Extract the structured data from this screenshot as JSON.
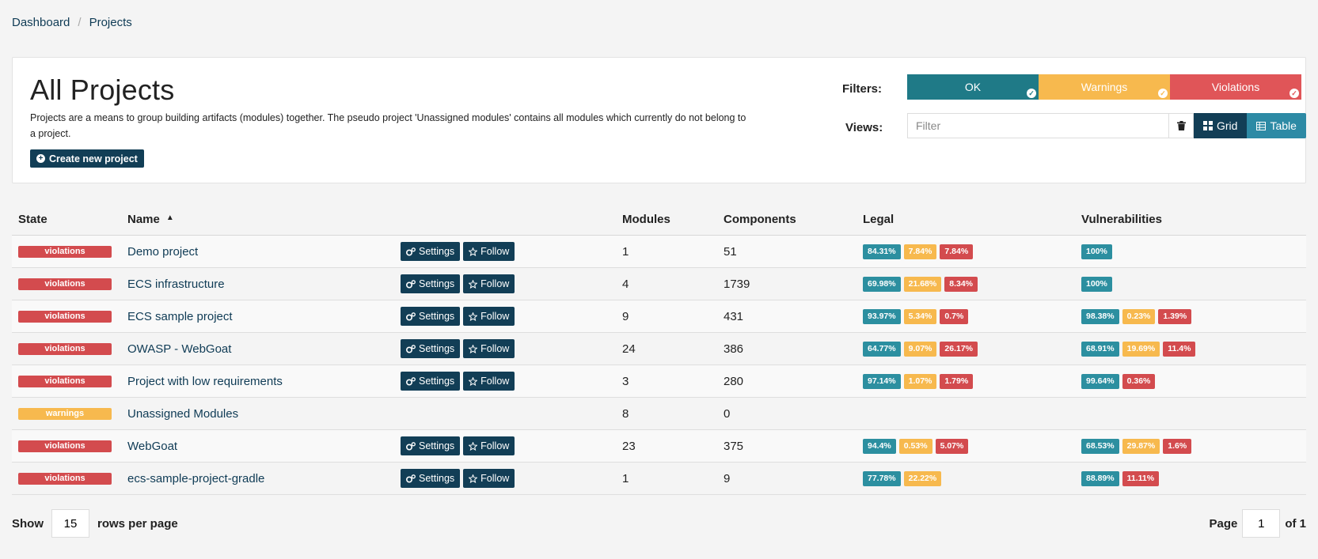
{
  "breadcrumb": {
    "items": [
      "Dashboard",
      "Projects"
    ],
    "separator": "/"
  },
  "header": {
    "title": "All Projects",
    "description": "Projects are a means to group building artifacts (modules) together. The pseudo project 'Unassigned modules' contains all modules which currently do not belong to a project.",
    "create_button": "Create new project"
  },
  "filters": {
    "label": "Filters:",
    "ok": "OK",
    "warnings": "Warnings",
    "violations": "Violations"
  },
  "views": {
    "label": "Views:",
    "filter_placeholder": "Filter",
    "grid": "Grid",
    "table": "Table"
  },
  "table": {
    "headers": {
      "state": "State",
      "name": "Name",
      "modules": "Modules",
      "components": "Components",
      "legal": "Legal",
      "vulnerabilities": "Vulnerabilities"
    },
    "settings_label": "Settings",
    "follow_label": "Follow",
    "rows": [
      {
        "state": "violations",
        "name": "Demo project",
        "modules": "1",
        "components": "51",
        "legal": [
          "84.31%",
          "7.84%",
          "7.84%"
        ],
        "vuln": [
          "100%"
        ]
      },
      {
        "state": "violations",
        "name": "ECS infrastructure",
        "modules": "4",
        "components": "1739",
        "legal": [
          "69.98%",
          "21.68%",
          "8.34%"
        ],
        "vuln": [
          "100%"
        ]
      },
      {
        "state": "violations",
        "name": "ECS sample project",
        "modules": "9",
        "components": "431",
        "legal": [
          "93.97%",
          "5.34%",
          "0.7%"
        ],
        "vuln": [
          "98.38%",
          "0.23%",
          "1.39%"
        ]
      },
      {
        "state": "violations",
        "name": "OWASP - WebGoat",
        "modules": "24",
        "components": "386",
        "legal": [
          "64.77%",
          "9.07%",
          "26.17%"
        ],
        "vuln": [
          "68.91%",
          "19.69%",
          "11.4%"
        ]
      },
      {
        "state": "violations",
        "name": "Project with low requirements",
        "modules": "3",
        "components": "280",
        "legal": [
          "97.14%",
          "1.07%",
          "1.79%"
        ],
        "vuln": [
          "99.64%",
          "0.36%"
        ]
      },
      {
        "state": "warnings",
        "name": "Unassigned Modules",
        "modules": "8",
        "components": "0",
        "legal": [],
        "vuln": []
      },
      {
        "state": "violations",
        "name": "WebGoat",
        "modules": "23",
        "components": "375",
        "legal": [
          "94.4%",
          "0.53%",
          "5.07%"
        ],
        "vuln": [
          "68.53%",
          "29.87%",
          "1.6%"
        ]
      },
      {
        "state": "violations",
        "name": "ecs-sample-project-gradle",
        "modules": "1",
        "components": "9",
        "legal": [
          "77.78%",
          "22.22%"
        ],
        "vuln": [
          "88.89%",
          "11.11%"
        ]
      }
    ]
  },
  "pagination": {
    "show_label": "Show",
    "rows_per_page": "15",
    "rows_label": "rows per page",
    "page_label": "Page",
    "page": "1",
    "of_label": "of 1"
  },
  "colors": {
    "ok": "#1f7a87",
    "warning": "#f7b94e",
    "violation": "#d34b4e",
    "primary": "#123e56"
  }
}
